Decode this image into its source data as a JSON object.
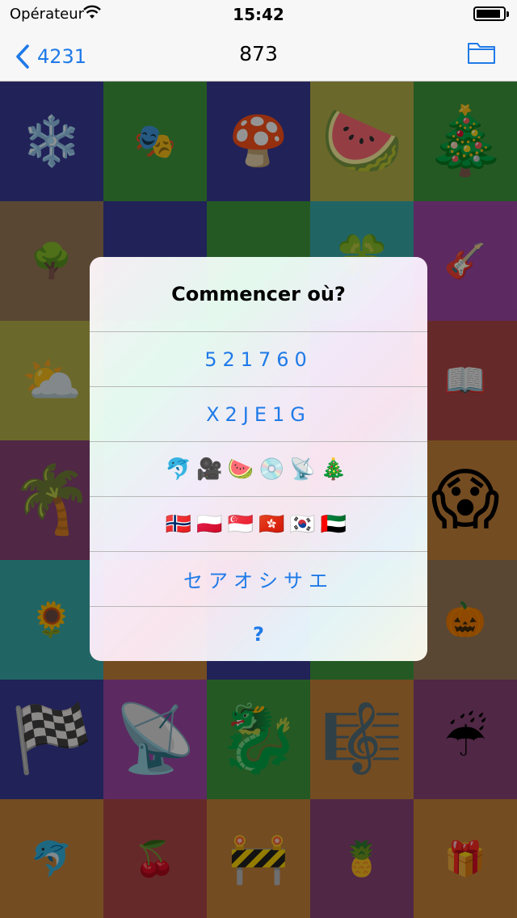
{
  "status_bar": {
    "carrier": "Opérateur",
    "time": "15:42",
    "battery_level": 0.9
  },
  "nav": {
    "back_label": "4231",
    "title": "873",
    "right_icon": "folder-icon"
  },
  "grid": {
    "cells": [
      {
        "emoji": "❄️",
        "bg": "#3a3c98",
        "size": "m",
        "name": "snowflake"
      },
      {
        "emoji": "🎭",
        "bg": "#3e9a3e",
        "size": "s",
        "name": "performing-arts"
      },
      {
        "emoji": "🍄",
        "bg": "#3a3c98",
        "size": "m",
        "name": "mushroom"
      },
      {
        "emoji": "🍉",
        "bg": "#b8b44a",
        "size": "l",
        "name": "watermelon"
      },
      {
        "emoji": "🎄",
        "bg": "#3e9a3e",
        "size": "l",
        "name": "christmas-tree"
      },
      {
        "emoji": "🌳",
        "bg": "#9a7a58",
        "size": "s",
        "name": "tree"
      },
      {
        "emoji": "",
        "bg": "#3a3c98",
        "size": "m",
        "name": "blank"
      },
      {
        "emoji": "",
        "bg": "#3e9a3e",
        "size": "m",
        "name": "blank"
      },
      {
        "emoji": "🍀",
        "bg": "#3aacac",
        "size": "m",
        "name": "clover"
      },
      {
        "emoji": "🎸",
        "bg": "#a048a8",
        "size": "s",
        "name": "guitar"
      },
      {
        "emoji": "⛅",
        "bg": "#b8b44a",
        "size": "m",
        "name": "sun-cloud"
      },
      {
        "emoji": "",
        "bg": "#3aacac",
        "size": "m",
        "name": "blank"
      },
      {
        "emoji": "",
        "bg": "#3e9a3e",
        "size": "m",
        "name": "blank"
      },
      {
        "emoji": "",
        "bg": "#3a3c98",
        "size": "m",
        "name": "blank"
      },
      {
        "emoji": "📖",
        "bg": "#b04848",
        "size": "s",
        "name": "open-book"
      },
      {
        "emoji": "🌴",
        "bg": "#8a4478",
        "size": "l",
        "name": "palm-tree"
      },
      {
        "emoji": "",
        "bg": "#3aacac",
        "size": "m",
        "name": "blank"
      },
      {
        "emoji": "",
        "bg": "#3e9a3e",
        "size": "m",
        "name": "blank"
      },
      {
        "emoji": "",
        "bg": "#a048a8",
        "size": "m",
        "name": "blank"
      },
      {
        "emoji": "😱",
        "bg": "#c8843a",
        "size": "l",
        "name": "scream"
      },
      {
        "emoji": "🌻",
        "bg": "#3aacac",
        "size": "s",
        "name": "sunflower"
      },
      {
        "emoji": "",
        "bg": "#c8843a",
        "size": "m",
        "name": "blank"
      },
      {
        "emoji": "",
        "bg": "#3a3c98",
        "size": "m",
        "name": "blank"
      },
      {
        "emoji": "",
        "bg": "#3e9a3e",
        "size": "m",
        "name": "blank"
      },
      {
        "emoji": "🎃",
        "bg": "#9a7a58",
        "size": "s",
        "name": "jack-o-lantern"
      },
      {
        "emoji": "🏁",
        "bg": "#3a3c98",
        "size": "l",
        "name": "checkered-flag"
      },
      {
        "emoji": "📡",
        "bg": "#a048a8",
        "size": "l",
        "name": "satellite-dish"
      },
      {
        "emoji": "🐉",
        "bg": "#3e9a3e",
        "size": "l",
        "name": "dragon"
      },
      {
        "emoji": "🎼",
        "bg": "#c8843a",
        "size": "l",
        "name": "musical-score"
      },
      {
        "emoji": "☔",
        "bg": "#8a4478",
        "size": "m",
        "name": "umbrella-rain"
      },
      {
        "emoji": "🐬",
        "bg": "#c8843a",
        "size": "s",
        "name": "dolphin"
      },
      {
        "emoji": "🍒",
        "bg": "#b04848",
        "size": "s",
        "name": "cherries"
      },
      {
        "emoji": "🚧",
        "bg": "#c8843a",
        "size": "m",
        "name": "construction"
      },
      {
        "emoji": "🍍",
        "bg": "#8a4478",
        "size": "s",
        "name": "pineapple"
      },
      {
        "emoji": "🎁",
        "bg": "#c8843a",
        "size": "s",
        "name": "gift"
      }
    ]
  },
  "alert": {
    "title": "Commencer où?",
    "options": [
      {
        "label": "521760",
        "type": "text",
        "name": "option-digits"
      },
      {
        "label": "X2JE1G",
        "type": "text",
        "name": "option-alphanumeric"
      },
      {
        "label": "🐬🎥🍉💿📡🎄",
        "type": "emoji",
        "name": "option-emoji"
      },
      {
        "label": "🇳🇴🇵🇱🇸🇬🇭🇰🇰🇷🇦🇪",
        "type": "emoji",
        "name": "option-flags"
      },
      {
        "label": "セアオシサエ",
        "type": "text",
        "name": "option-katakana"
      },
      {
        "label": "?",
        "type": "q",
        "name": "option-random"
      }
    ]
  },
  "colors": {
    "accent": "#1f7ae8",
    "bar_bg": "#f7f7f7"
  }
}
